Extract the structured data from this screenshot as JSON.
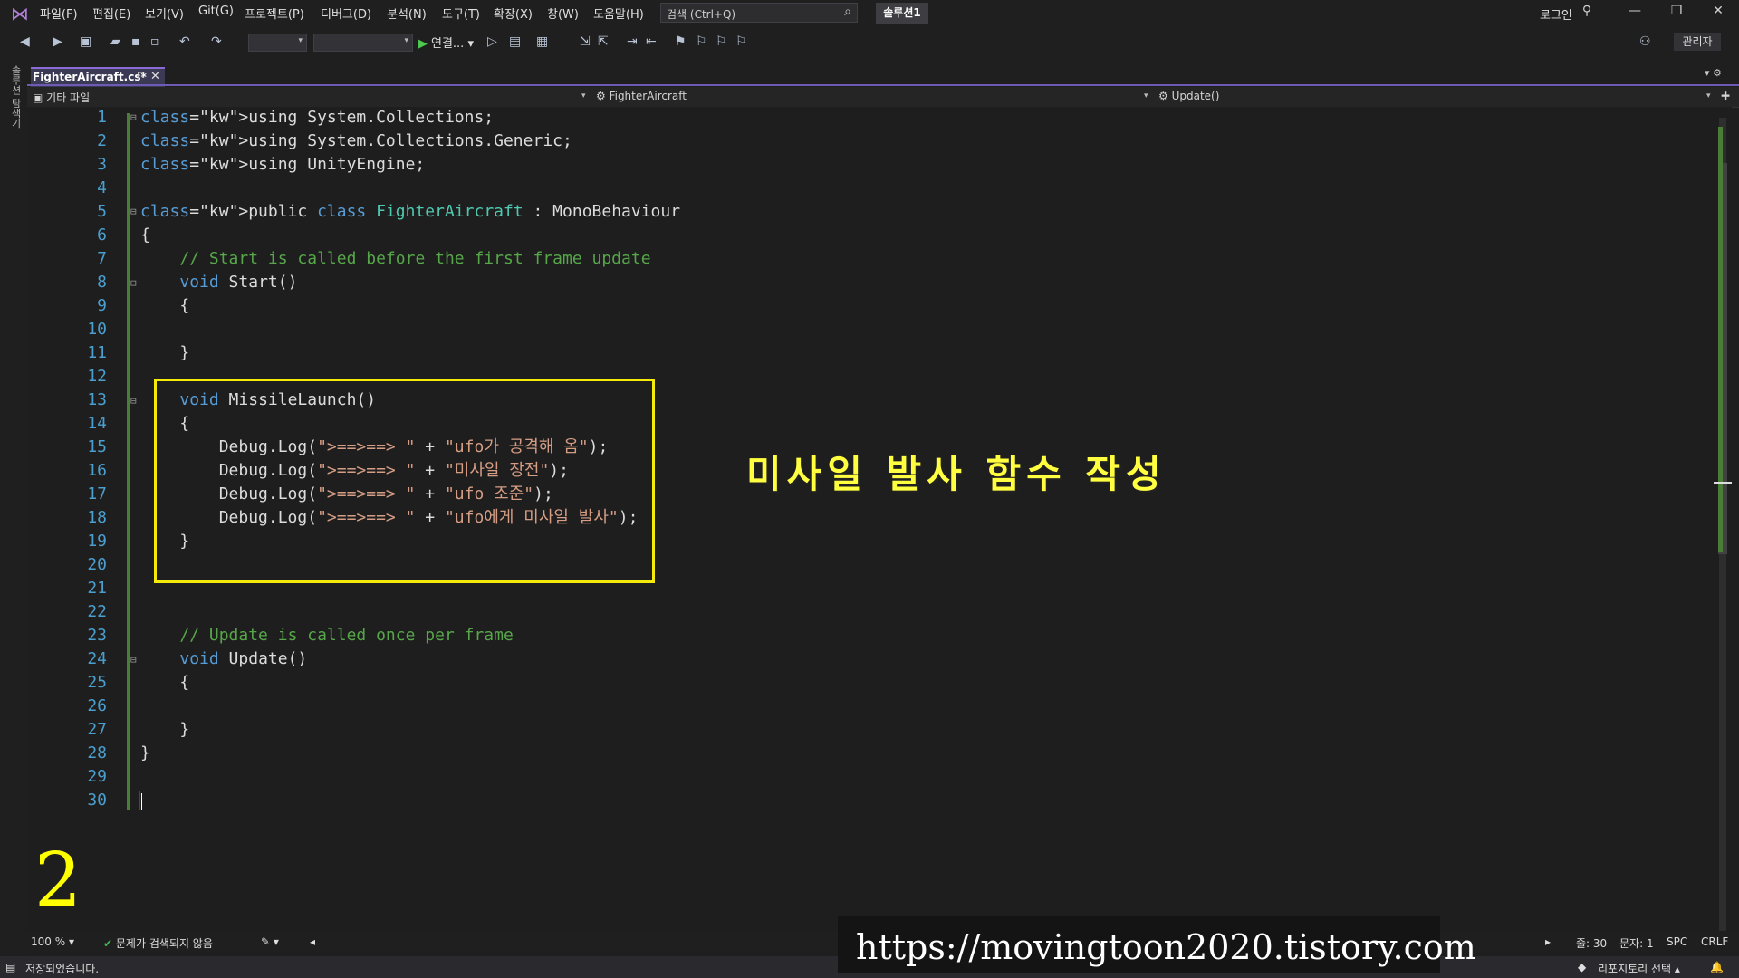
{
  "menu": [
    "파일(F)",
    "편집(E)",
    "보기(V)",
    "Git(G)",
    "프로젝트(P)",
    "디버그(D)",
    "분석(N)",
    "도구(T)",
    "확장(X)",
    "창(W)",
    "도움말(H)"
  ],
  "search": {
    "placeholder": "검색 (Ctrl+Q)"
  },
  "solution_name": "솔루션1",
  "login_label": "로그인",
  "toolbar": {
    "run_label": "연결...",
    "admin_label": "관리자"
  },
  "left_rail_label": "솔루션 탐색기",
  "tab": {
    "title": "FighterAircraft.cs*"
  },
  "navbar": {
    "scope": "기타 파일",
    "class_name": "FighterAircraft",
    "member": "Update()"
  },
  "code_lines": [
    "using System.Collections;",
    "using System.Collections.Generic;",
    "using UnityEngine;",
    "",
    "public class FighterAircraft : MonoBehaviour",
    "{",
    "    // Start is called before the first frame update",
    "    void Start()",
    "    {",
    "",
    "    }",
    "",
    "    void MissileLaunch()",
    "    {",
    "        Debug.Log(\">==>==> \" + \"ufo가 공격해 옴\");",
    "        Debug.Log(\">==>==> \" + \"미사일 장전\");",
    "        Debug.Log(\">==>==> \" + \"ufo 조준\");",
    "        Debug.Log(\">==>==> \" + \"ufo에게 미사일 발사\");",
    "    }",
    "",
    "",
    "",
    "    // Update is called once per frame",
    "    void Update()",
    "    {",
    "",
    "    }",
    "}",
    "",
    ""
  ],
  "annotation": "미사일 발사 함수 작성",
  "step_number": "2",
  "editor_status": {
    "zoom": "100 %",
    "issues": "문제가 검색되지 않음",
    "line": "줄: 30",
    "char": "문자: 1",
    "spc": "SPC",
    "eol": "CRLF"
  },
  "statusbar": {
    "message": "저장되었습니다.",
    "repo": "리포지토리 선택"
  },
  "watermark": "https://movingtoon2020.tistory.com",
  "colors": {
    "keyword": "#569cd6",
    "type": "#4ec9b0",
    "comment": "#57a64a",
    "string": "#d69d85",
    "highlight": "#f5eb0b"
  }
}
